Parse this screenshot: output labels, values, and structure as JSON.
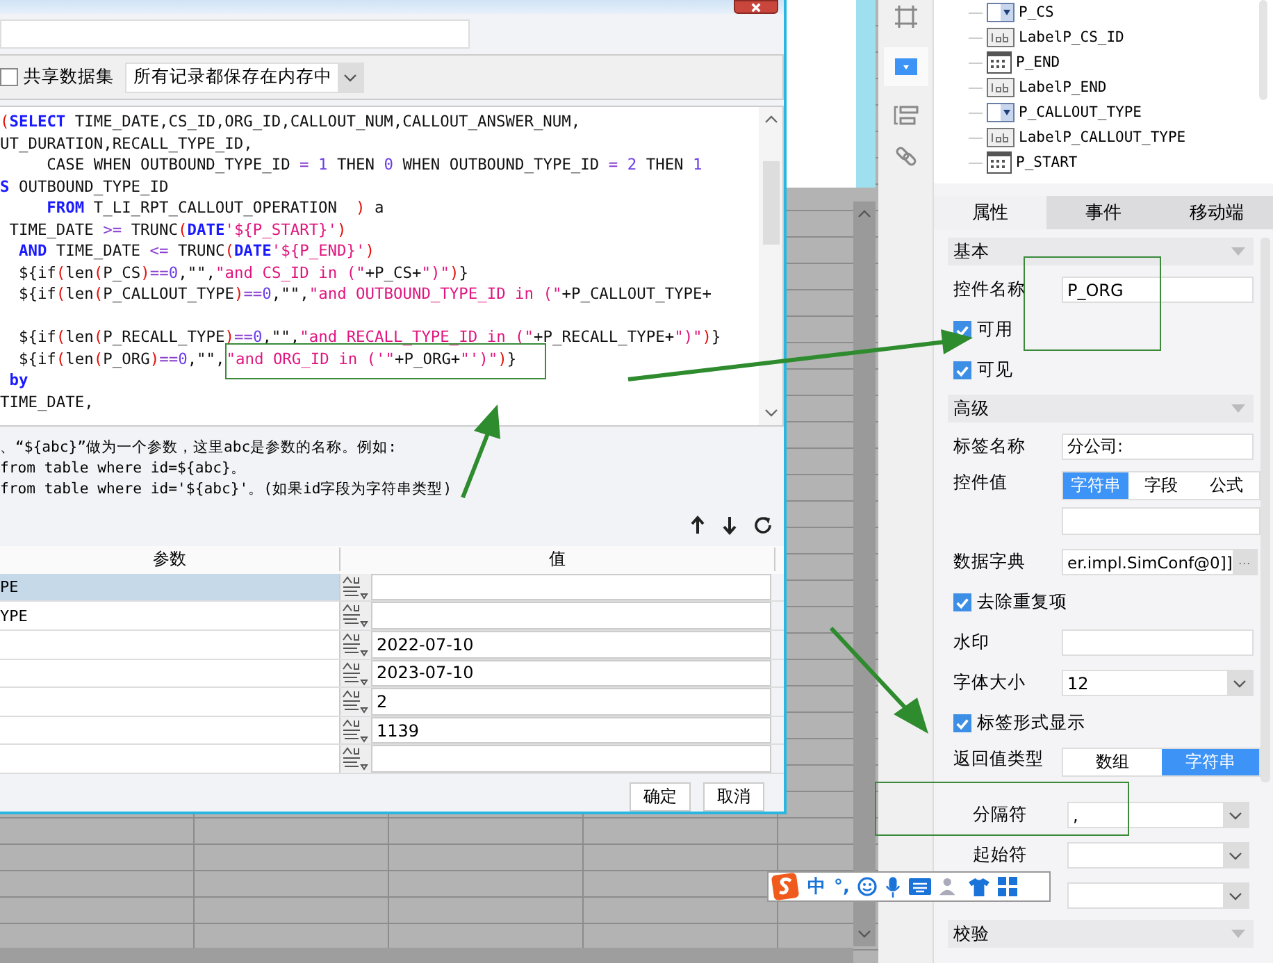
{
  "dialog": {
    "share_dataset": {
      "label": "共享数据集",
      "checked": false
    },
    "storage_mode": "所有记录都保存在内存中",
    "sql_lines": [
      {
        "tokens": [
          {
            "kind": "paren",
            "text": "("
          },
          {
            "kind": "keyword",
            "text": "SELECT"
          },
          {
            "kind": "plain",
            "text": " TIME_DATE,CS_ID,ORG_ID,CALLOUT_NUM,CALLOUT_ANSWER_NUM,"
          }
        ]
      },
      {
        "tokens": [
          {
            "kind": "plain",
            "text": "UT_DURATION,RECALL_TYPE_ID,"
          }
        ]
      },
      {
        "tokens": [
          {
            "kind": "plain",
            "text": "     CASE WHEN OUTBOUND_TYPE_ID "
          },
          {
            "kind": "operator",
            "text": "="
          },
          {
            "kind": "number",
            "text": " 1"
          },
          {
            "kind": "plain",
            "text": " THEN "
          },
          {
            "kind": "number",
            "text": "0"
          },
          {
            "kind": "plain",
            "text": " WHEN OUTBOUND_TYPE_ID "
          },
          {
            "kind": "operator",
            "text": "="
          },
          {
            "kind": "number",
            "text": " 2"
          },
          {
            "kind": "plain",
            "text": " THEN "
          },
          {
            "kind": "number",
            "text": "1"
          }
        ]
      },
      {
        "tokens": [
          {
            "kind": "keyword",
            "text": "S"
          },
          {
            "kind": "plain",
            "text": " OUTBOUND_TYPE_ID"
          }
        ]
      },
      {
        "tokens": [
          {
            "kind": "keyword",
            "text": "     FROM"
          },
          {
            "kind": "plain",
            "text": " T_LI_RPT_CALLOUT_OPERATION  "
          },
          {
            "kind": "paren",
            "text": ")"
          },
          {
            "kind": "plain",
            "text": " a"
          }
        ]
      },
      {
        "tokens": [
          {
            "kind": "plain",
            "text": " TIME_DATE "
          },
          {
            "kind": "operator",
            "text": ">="
          },
          {
            "kind": "plain",
            "text": " TRUNC"
          },
          {
            "kind": "paren",
            "text": "("
          },
          {
            "kind": "keyword",
            "text": "DATE"
          },
          {
            "kind": "string",
            "text": "'${P_START}'"
          },
          {
            "kind": "paren",
            "text": ")"
          }
        ]
      },
      {
        "tokens": [
          {
            "kind": "keyword",
            "text": "  AND"
          },
          {
            "kind": "plain",
            "text": " TIME_DATE "
          },
          {
            "kind": "operator",
            "text": "<="
          },
          {
            "kind": "plain",
            "text": " TRUNC"
          },
          {
            "kind": "paren",
            "text": "("
          },
          {
            "kind": "keyword",
            "text": "DATE"
          },
          {
            "kind": "string",
            "text": "'${P_END}'"
          },
          {
            "kind": "paren",
            "text": ")"
          }
        ]
      },
      {
        "tokens": [
          {
            "kind": "plain",
            "text": "  ${if"
          },
          {
            "kind": "paren",
            "text": "("
          },
          {
            "kind": "plain",
            "text": "len"
          },
          {
            "kind": "paren",
            "text": "("
          },
          {
            "kind": "plain",
            "text": "P_CS"
          },
          {
            "kind": "paren",
            "text": ")"
          },
          {
            "kind": "operator",
            "text": "=="
          },
          {
            "kind": "number",
            "text": "0"
          },
          {
            "kind": "plain",
            "text": ",\"\","
          },
          {
            "kind": "string",
            "text": "\"and CS_ID in (\""
          },
          {
            "kind": "plain",
            "text": "+P_CS+"
          },
          {
            "kind": "string",
            "text": "\")\""
          },
          {
            "kind": "paren",
            "text": ")"
          },
          {
            "kind": "plain",
            "text": "}"
          }
        ]
      },
      {
        "tokens": [
          {
            "kind": "plain",
            "text": "  ${if"
          },
          {
            "kind": "paren",
            "text": "("
          },
          {
            "kind": "plain",
            "text": "len"
          },
          {
            "kind": "paren",
            "text": "("
          },
          {
            "kind": "plain",
            "text": "P_CALLOUT_TYPE"
          },
          {
            "kind": "paren",
            "text": ")"
          },
          {
            "kind": "operator",
            "text": "=="
          },
          {
            "kind": "number",
            "text": "0"
          },
          {
            "kind": "plain",
            "text": ",\"\","
          },
          {
            "kind": "string",
            "text": "\"and OUTBOUND_TYPE_ID in (\""
          },
          {
            "kind": "plain",
            "text": "+P_CALLOUT_TYPE+"
          }
        ]
      },
      {
        "blank_before": true,
        "tokens": [
          {
            "kind": "plain",
            "text": "  ${if"
          },
          {
            "kind": "paren",
            "text": "("
          },
          {
            "kind": "plain",
            "text": "len"
          },
          {
            "kind": "paren",
            "text": "("
          },
          {
            "kind": "plain",
            "text": "P_RECALL_TYPE"
          },
          {
            "kind": "paren",
            "text": ")"
          },
          {
            "kind": "operator",
            "text": "=="
          },
          {
            "kind": "number",
            "text": "0"
          },
          {
            "kind": "plain",
            "text": ",\"\","
          },
          {
            "kind": "string",
            "text": "\"and RECALL_TYPE_ID in (\""
          },
          {
            "kind": "plain",
            "text": "+P_RECALL_TYPE+"
          },
          {
            "kind": "string",
            "text": "\")\""
          },
          {
            "kind": "paren",
            "text": ")"
          },
          {
            "kind": "plain",
            "text": "}"
          }
        ]
      },
      {
        "tokens": [
          {
            "kind": "plain",
            "text": "  ${if"
          },
          {
            "kind": "paren",
            "text": "("
          },
          {
            "kind": "plain",
            "text": "len"
          },
          {
            "kind": "paren",
            "text": "("
          },
          {
            "kind": "plain",
            "text": "P_ORG"
          },
          {
            "kind": "paren",
            "text": ")"
          },
          {
            "kind": "operator",
            "text": "=="
          },
          {
            "kind": "number",
            "text": "0"
          },
          {
            "kind": "plain",
            "text": ",\"\","
          }
        ],
        "highlighted_tokens": [
          {
            "kind": "string",
            "text": "\"and ORG_ID in ('\""
          },
          {
            "kind": "plain",
            "text": "+P_ORG+"
          },
          {
            "kind": "string",
            "text": "\"')\""
          },
          {
            "kind": "paren",
            "text": ")"
          },
          {
            "kind": "plain",
            "text": "}"
          }
        ]
      },
      {
        "tokens": [
          {
            "kind": "keyword",
            "text": " by"
          }
        ]
      },
      {
        "tokens": [
          {
            "kind": "plain",
            "text": "TIME_DATE,"
          }
        ]
      }
    ],
    "help_lines": [
      "、“${abc}”做为一个参数，这里abc是参数的名称。例如:",
      "from table where id=${abc}。",
      "from table where id='${abc}'。(如果id字段为字符串类型)"
    ],
    "param_table": {
      "columns": [
        "参数",
        "值"
      ],
      "rows": [
        {
          "name": "PE",
          "selected": true
        },
        {
          "name": "YPE",
          "selected": false
        },
        {
          "value": "2022-07-10",
          "selected": false
        },
        {
          "value": "2023-07-10",
          "selected": false
        },
        {
          "value": "2",
          "selected": false
        },
        {
          "value": "1139",
          "selected": false
        },
        {
          "selected": false
        }
      ]
    },
    "buttons": [
      "确定",
      "取消"
    ]
  },
  "tree": [
    {
      "label": "P_CS",
      "kind": "combo"
    },
    {
      "label": "LabelP_CS_ID",
      "kind": "label"
    },
    {
      "label": "P_END",
      "kind": "date"
    },
    {
      "label": "LabelP_END",
      "kind": "label"
    },
    {
      "label": "P_CALLOUT_TYPE",
      "kind": "combo"
    },
    {
      "label": "LabelP_CALLOUT_TYPE",
      "kind": "label"
    },
    {
      "label": "P_START",
      "kind": "date"
    }
  ],
  "tabs": [
    {
      "label": "属性",
      "selected": true
    },
    {
      "label": "事件",
      "selected": false
    },
    {
      "label": "移动端",
      "selected": false
    }
  ],
  "properties": [
    {
      "kind": "section",
      "label": "基本"
    },
    {
      "kind": "text",
      "label": "控件名称",
      "value": "P_ORG"
    },
    {
      "kind": "check",
      "label": "可用",
      "checked": true
    },
    {
      "kind": "check",
      "label": "可见",
      "checked": true
    },
    {
      "kind": "section",
      "label": "高级"
    },
    {
      "kind": "text",
      "label": "标签名称",
      "value": "分公司:"
    },
    {
      "kind": "segmented",
      "label": "控件值",
      "options": [
        {
          "label": "字符串",
          "selected": true
        },
        {
          "label": "字段",
          "selected": false
        },
        {
          "label": "公式",
          "selected": false
        }
      ],
      "with_field": true
    },
    {
      "kind": "picker",
      "label": "数据字典",
      "value": "er.impl.SimConf@0]]",
      "button": "···"
    },
    {
      "kind": "check",
      "label": "去除重复项",
      "checked": true
    },
    {
      "kind": "text",
      "label": "水印"
    },
    {
      "kind": "select",
      "label": "字体大小",
      "value": "12"
    },
    {
      "kind": "check",
      "label": "标签形式显示",
      "checked": true
    },
    {
      "kind": "segmented",
      "label": "返回值类型",
      "options": [
        {
          "label": "数组",
          "selected": false
        },
        {
          "label": "字符串",
          "selected": true
        }
      ]
    },
    {
      "kind": "subselect",
      "label": "分隔符",
      "value": ","
    },
    {
      "kind": "subselect",
      "label": "起始符"
    },
    {
      "kind": "subselect"
    },
    {
      "kind": "section",
      "label": "校验"
    }
  ],
  "ime": {
    "mode": "中",
    "punctuation": "°,"
  }
}
